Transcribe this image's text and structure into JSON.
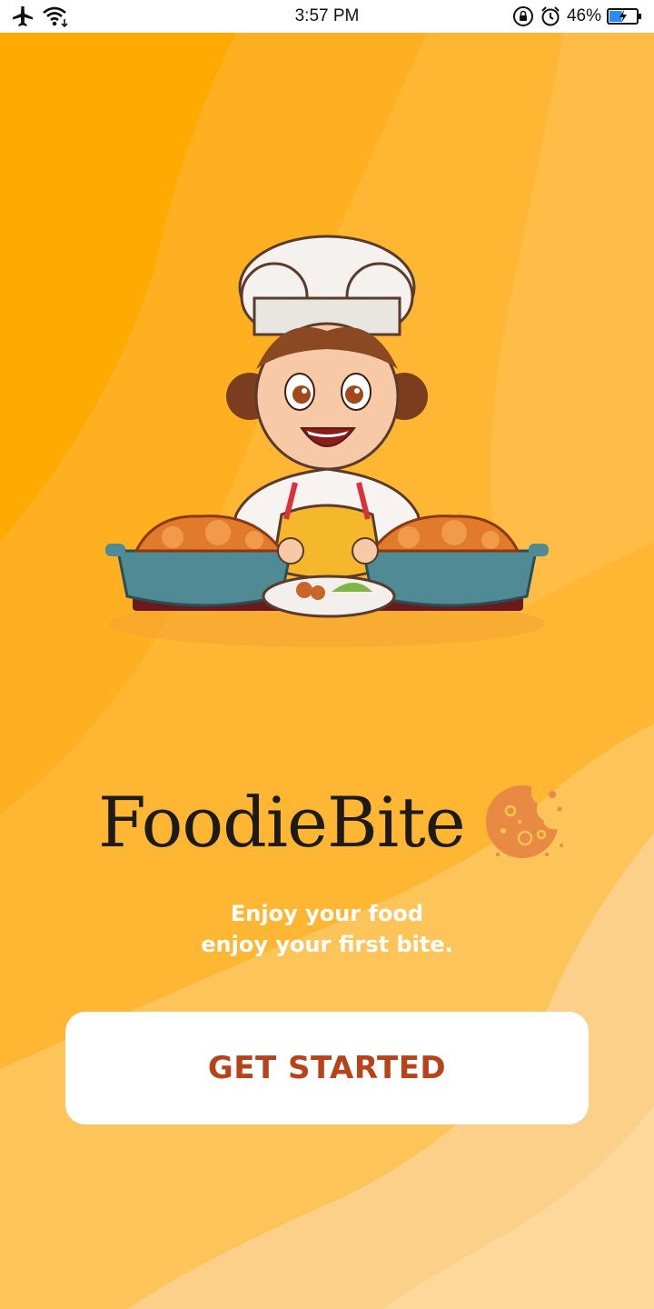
{
  "status_bar": {
    "time": "3:57 PM",
    "battery_percent": "46%",
    "battery_level": 0.46,
    "icons": [
      "airplane-icon",
      "wifi-icon",
      "rotation-lock-icon",
      "alarm-icon",
      "battery-icon"
    ]
  },
  "splash": {
    "app_name": "FoodieBite",
    "tagline_line1": "Enjoy your food",
    "tagline_line2": "enjoy your first bite.",
    "illustration": "chef-girl-with-food-trays",
    "logo_icon": "cookie-icon"
  },
  "cta": {
    "label": "GET STARTED"
  },
  "colors": {
    "background": "#ffb733",
    "wave_light": "#fdd89a",
    "wave_deep": "#ffaa00",
    "brand_text": "#1e1a18",
    "button_text": "#b8421a",
    "button_bg": "#ffffff",
    "cookie": "#e98a44"
  }
}
